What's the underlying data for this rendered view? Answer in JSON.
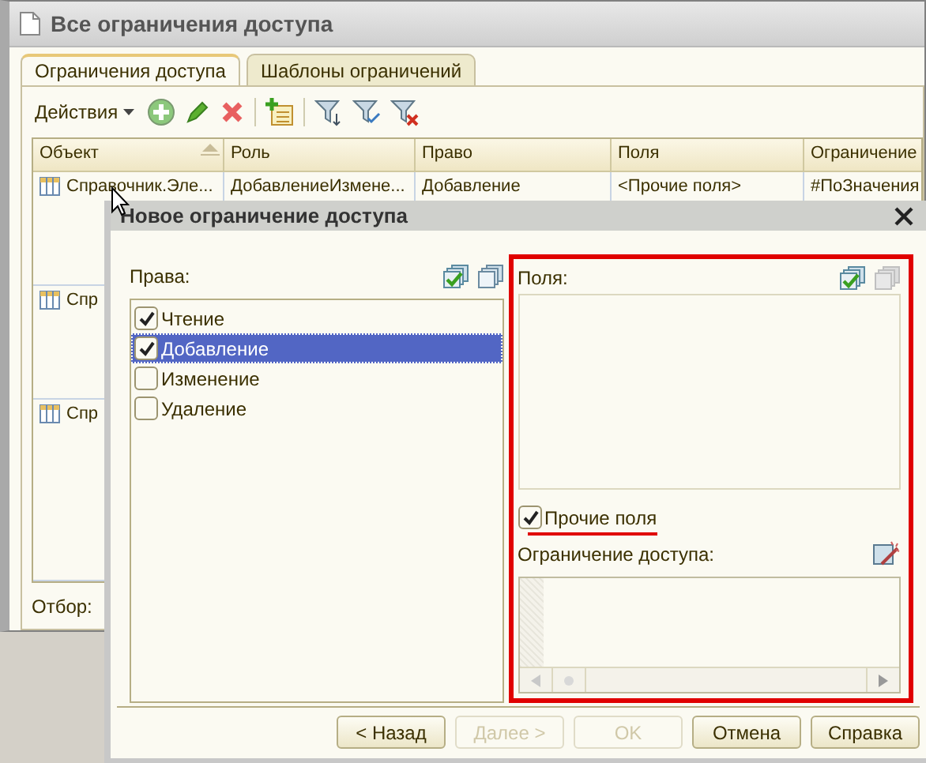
{
  "window": {
    "title": "Все ограничения доступа"
  },
  "tabs": [
    {
      "label": "Ограничения доступа",
      "selected": true
    },
    {
      "label": "Шаблоны ограничений",
      "selected": false
    }
  ],
  "toolbar": {
    "actions_label": "Действия"
  },
  "table": {
    "columns": [
      "Объект",
      "Роль",
      "Право",
      "Поля",
      "Ограничение"
    ],
    "rows": [
      {
        "cells": [
          "Справочник.Эле...",
          "ДобавлениеИзмене...",
          "Добавление",
          "<Прочие поля>",
          "#ПоЗначения"
        ]
      },
      {
        "cells": [
          "Спр"
        ]
      },
      {
        "cells": [
          "Спр"
        ]
      }
    ]
  },
  "filter_label": "Отбор:",
  "dialog": {
    "title": "Новое ограничение доступа",
    "rights_label": "Права:",
    "rights": [
      {
        "label": "Чтение",
        "checked": true,
        "selected": false
      },
      {
        "label": "Добавление",
        "checked": true,
        "selected": true
      },
      {
        "label": "Изменение",
        "checked": false,
        "selected": false
      },
      {
        "label": "Удаление",
        "checked": false,
        "selected": false
      }
    ],
    "fields_label": "Поля:",
    "other_fields": {
      "label": "Прочие поля",
      "checked": true
    },
    "restriction_label": "Ограничение доступа:",
    "buttons": [
      {
        "label": "< Назад",
        "disabled": false
      },
      {
        "label": "Далее >",
        "disabled": true
      },
      {
        "label": "OK",
        "disabled": true
      },
      {
        "label": "Отмена",
        "disabled": false
      },
      {
        "label": "Справка",
        "disabled": false
      }
    ]
  }
}
